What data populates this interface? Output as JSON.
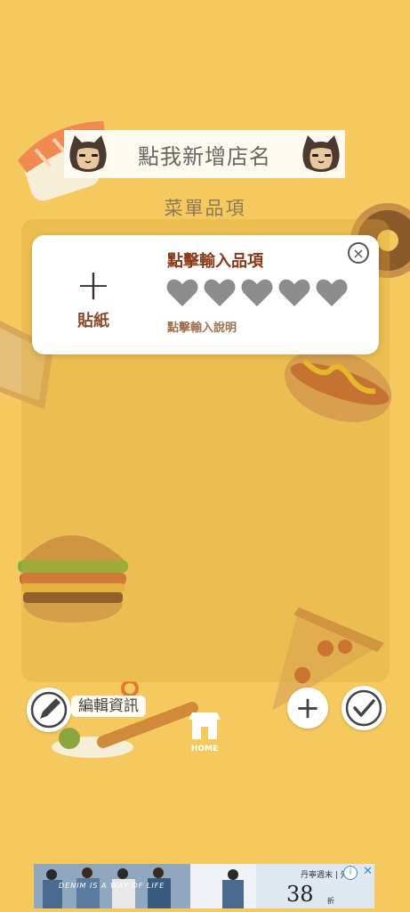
{
  "header": {
    "store_name_placeholder": "點我新增店名",
    "menu_title": "菜單品項"
  },
  "card": {
    "sticker_label": "貼紙",
    "sticker_plus": "+",
    "item_name_placeholder": "點擊輸入品項",
    "rating": 0,
    "rating_max": 5,
    "description_placeholder": "點擊輸入說明",
    "close_glyph": "×"
  },
  "toolbar": {
    "edit_label": "編輯資訊",
    "home_label": "HOME",
    "add_glyph": "+"
  },
  "ad": {
    "tagline": "DENIM IS A WAY OF LIFE",
    "promo": "丹寧週末 | 外套",
    "price": "38",
    "price_unit": "折",
    "info_glyph": "i",
    "close_glyph": "✕"
  },
  "colors": {
    "background": "#f5c95e",
    "item_name": "#8a3a1a",
    "heart_gray": "#8c8c8c"
  }
}
